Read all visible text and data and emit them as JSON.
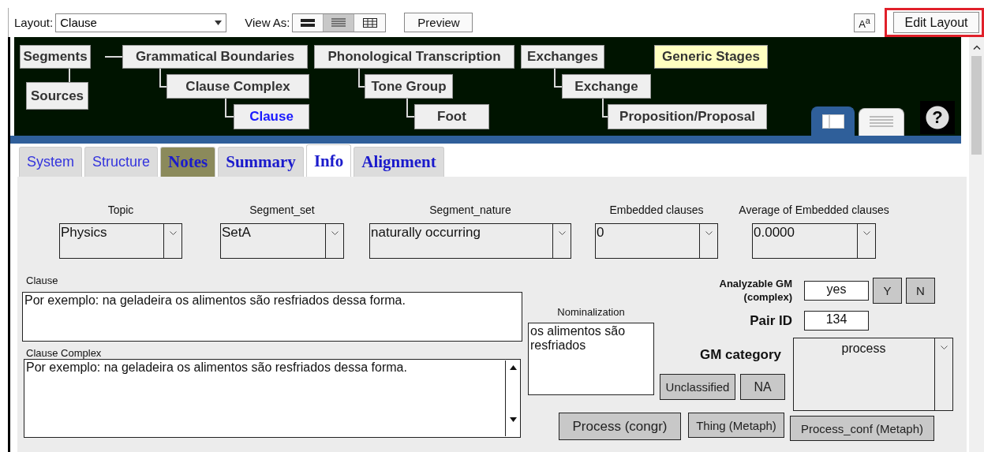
{
  "toolbar": {
    "layout_label": "Layout:",
    "layout_value": "Clause",
    "view_as_label": "View As:",
    "view_modes": [
      {
        "kind": "form",
        "selected": false
      },
      {
        "kind": "list",
        "selected": true
      },
      {
        "kind": "table",
        "selected": false
      }
    ],
    "preview_button": "Preview",
    "text_size_button": "A$^{a}$",
    "edit_layout_button": "Edit Layout"
  },
  "navigator": {
    "nodes": [
      {
        "label": "Segments",
        "current": false,
        "highlighted": false
      },
      {
        "label": "Sources",
        "current": false,
        "highlighted": false
      },
      {
        "label": "Grammatical Boundaries",
        "current": false,
        "highlighted": false
      },
      {
        "label": "Clause Complex",
        "current": false,
        "highlighted": false
      },
      {
        "label": "Clause",
        "current": true,
        "highlighted": false
      },
      {
        "label": "Phonological Transcription",
        "current": false,
        "highlighted": false
      },
      {
        "label": "Tone Group",
        "current": false,
        "highlighted": false
      },
      {
        "label": "Foot",
        "current": false,
        "highlighted": false
      },
      {
        "label": "Exchanges",
        "current": false,
        "highlighted": false
      },
      {
        "label": "Generic Stages",
        "current": false,
        "highlighted": true
      },
      {
        "label": "Exchange",
        "current": false,
        "highlighted": false
      },
      {
        "label": "Proposition/Proposal",
        "current": false,
        "highlighted": false
      }
    ],
    "view_tabs": [
      {
        "kind": "form",
        "selected": true
      },
      {
        "kind": "list",
        "selected": false
      }
    ],
    "help_button": "?"
  },
  "tabs": [
    {
      "label": "System",
      "kind": "plain",
      "highlighted": false,
      "selected": false
    },
    {
      "label": "Structure",
      "kind": "plain",
      "highlighted": false,
      "selected": false
    },
    {
      "label": "Notes",
      "kind": "bold",
      "highlighted": true,
      "selected": false
    },
    {
      "label": "Summary",
      "kind": "bold",
      "highlighted": false,
      "selected": false
    },
    {
      "label": "Info",
      "kind": "bold",
      "highlighted": false,
      "selected": true
    },
    {
      "label": "Alignment",
      "kind": "bold",
      "highlighted": false,
      "selected": false
    }
  ],
  "info_form": {
    "dropdowns": [
      {
        "label": "Topic",
        "value": "Physics"
      },
      {
        "label": "Segment_set",
        "value": "SetA"
      },
      {
        "label": "Segment_nature",
        "value": "naturally occurring"
      },
      {
        "label": "Embedded clauses",
        "value": "0"
      },
      {
        "label": "Average of Embedded clauses",
        "value": "0.0000"
      }
    ],
    "clause": {
      "label": "Clause",
      "value": "Por exemplo: na geladeira os alimentos são resfriados dessa forma."
    },
    "clause_complex": {
      "label": "Clause Complex",
      "value": "Por exemplo: na geladeira os alimentos são resfriados dessa forma."
    },
    "nominalization": {
      "label": "Nominalization",
      "value": "os alimentos são resfriados"
    },
    "analyzable": {
      "label": "Analyzable GM (complex)",
      "value": "yes",
      "buttons": [
        "Y",
        "N"
      ]
    },
    "pair_id": {
      "label": "Pair ID",
      "value": "134"
    },
    "gm_category": {
      "label": "GM category",
      "value": "process",
      "buttons": [
        "Unclassified",
        "NA"
      ]
    },
    "action_buttons": [
      "Process (congr)",
      "Thing (Metaph)",
      "Process_conf (Metaph)"
    ]
  }
}
